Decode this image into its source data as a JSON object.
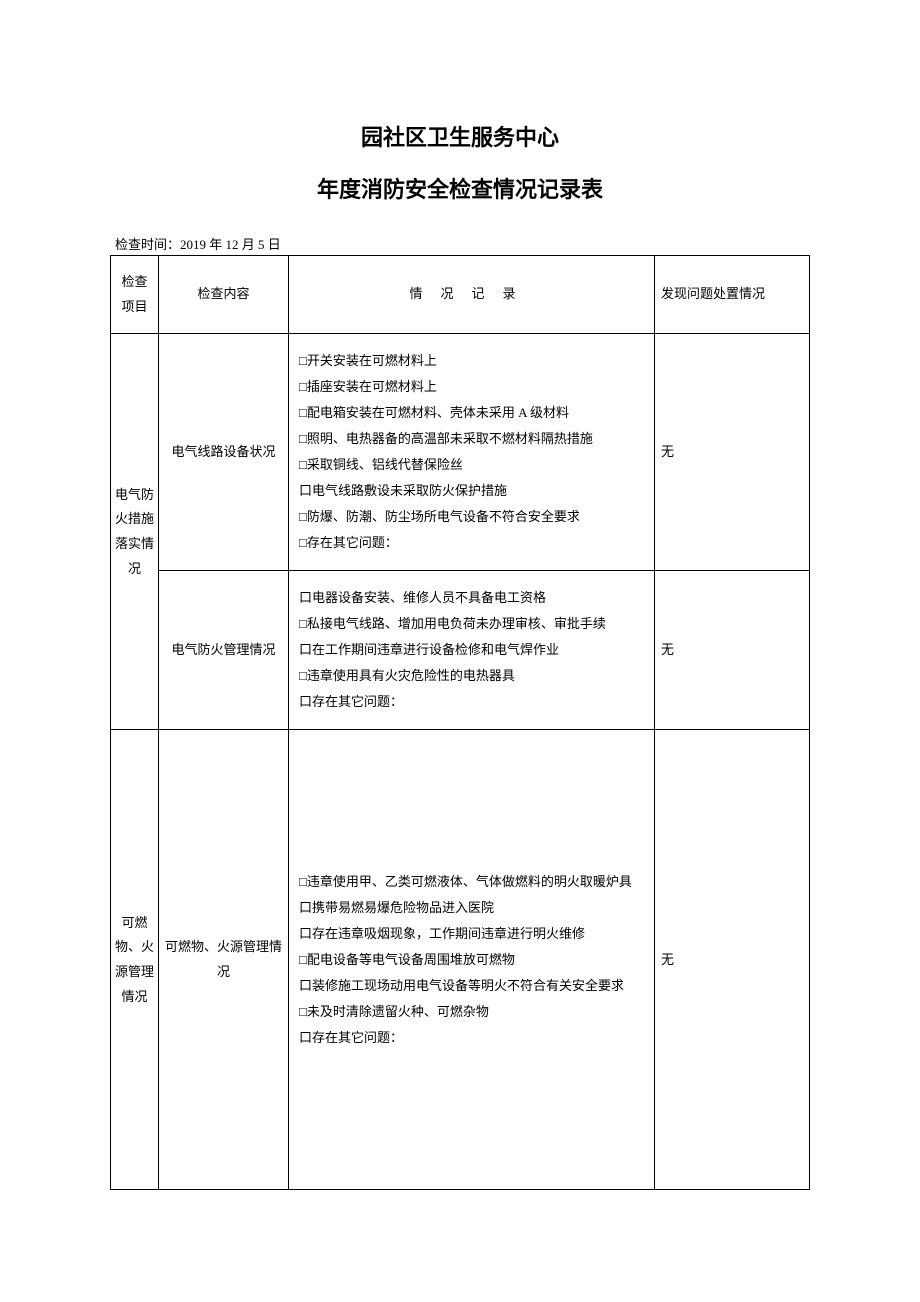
{
  "title": "园社区卫生服务中心",
  "subtitle": "年度消防安全检查情况记录表",
  "date_label": "检查时间：",
  "date_value": "2019 年 12 月 5 日",
  "headers": {
    "category": "检查项目",
    "content": "检查内容",
    "record": "情况记录",
    "result": "发现问题处置情况"
  },
  "sections": [
    {
      "category": "电气防火措施落实情况",
      "rows": [
        {
          "content": "电气线路设备状况",
          "records": [
            "□开关安装在可燃材料上",
            "□插座安装在可燃材料上",
            "□配电箱安装在可燃材料、壳体未采用 A 级材料",
            "□照明、电热器备的高温部未采取不燃材料隔热措施",
            "□采取铜线、铝线代替保险丝",
            "口电气线路敷设未采取防火保护措施",
            "□防爆、防潮、防尘场所电气设备不符合安全要求",
            "□存在其它问题："
          ],
          "result": "无"
        },
        {
          "content": "电气防火管理情况",
          "records": [
            "口电器设备安装、维修人员不具备电工资格",
            "□私接电气线路、增加用电负荷未办理审核、审批手续",
            "口在工作期间违章进行设备检修和电气焊作业",
            "□违章使用具有火灾危险性的电热器具",
            "口存在其它问题："
          ],
          "result": "无"
        }
      ]
    },
    {
      "category": "可燃物、火源管理情况",
      "rows": [
        {
          "content": "可燃物、火源管理情况",
          "records": [
            "□违章使用甲、乙类可燃液体、气体做燃料的明火取暖炉具",
            "口携带易燃易爆危险物品进入医院",
            "口存在违章吸烟现象，工作期间违章进行明火维修",
            "□配电设备等电气设备周围堆放可燃物",
            "口装修施工现场动用电气设备等明火不符合有关安全要求",
            "□未及时清除遗留火种、可燃杂物",
            "口存在其它问题："
          ],
          "result": "无"
        }
      ]
    }
  ]
}
